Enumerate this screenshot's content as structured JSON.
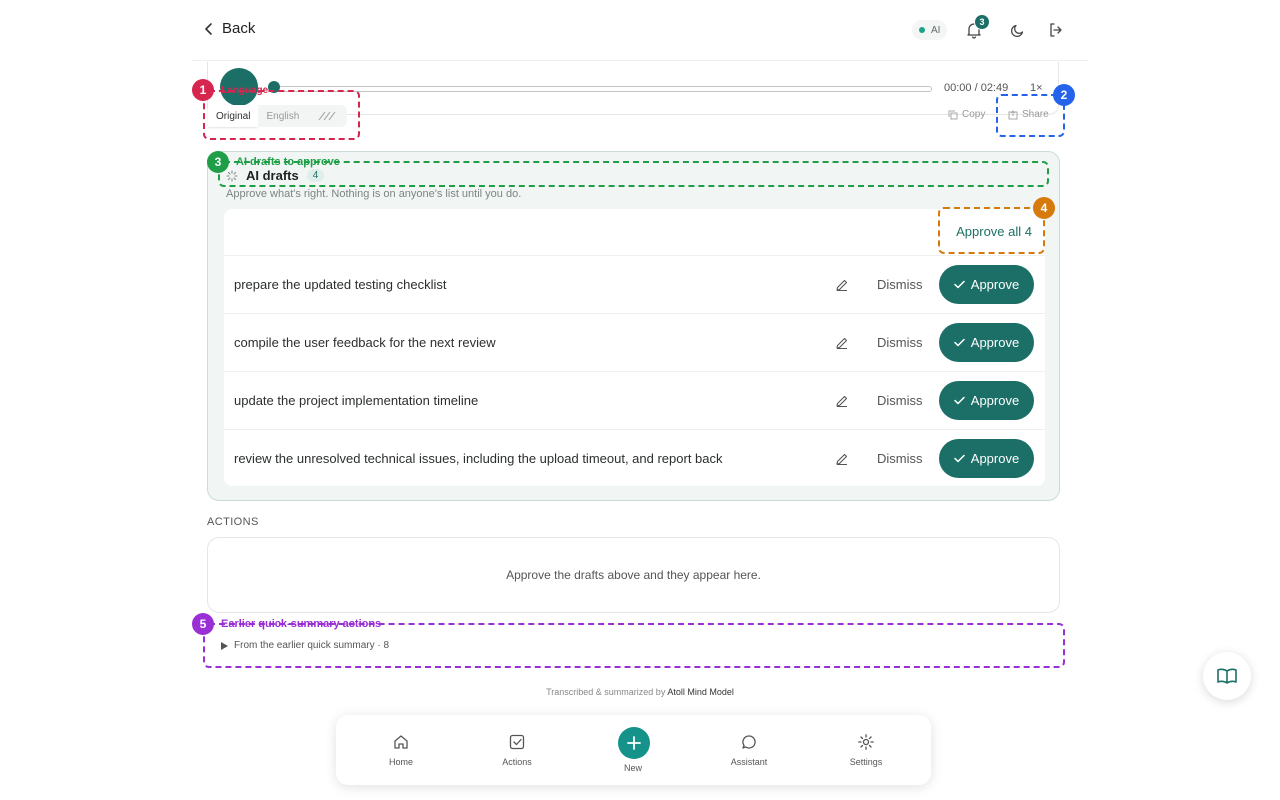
{
  "header": {
    "back_label": "Back",
    "ai_status": "AI",
    "notification_count": "3"
  },
  "player": {
    "time": "00:00 / 02:49",
    "speed": "1×",
    "progress": 0.0
  },
  "language": {
    "original": "Original",
    "english": "English"
  },
  "transcript_actions": {
    "copy": "Copy",
    "share": "Share"
  },
  "drafts": {
    "title": "AI drafts",
    "count": "4",
    "subtitle": "Approve what's right. Nothing is on anyone's list until you do.",
    "approve_all": "Approve all 4",
    "dismiss_label": "Dismiss",
    "approve_label": "Approve",
    "items": [
      {
        "text": "prepare the updated testing checklist"
      },
      {
        "text": "compile the user feedback for the next review"
      },
      {
        "text": "update the project implementation timeline"
      },
      {
        "text": "review the unresolved technical issues, including the upload timeout, and report back"
      }
    ]
  },
  "actions": {
    "label": "ACTIONS",
    "empty": "Approve the drafts above and they appear here."
  },
  "earlier": {
    "label": "From the earlier quick summary · 8"
  },
  "footer": {
    "credit_prefix": "Transcribed & summarized by",
    "credit_model": "Atoll Mind Model"
  },
  "nav": {
    "home": "Home",
    "actions": "Actions",
    "new": "New",
    "assistant": "Assistant",
    "settings": "Settings"
  },
  "annotations": [
    {
      "n": "1",
      "label": "Language",
      "color": "#d6264f"
    },
    {
      "n": "2",
      "label": "",
      "color": "#2563eb"
    },
    {
      "n": "3",
      "label": "AI drafts to approve",
      "color": "#1f9e47"
    },
    {
      "n": "4",
      "label": "",
      "color": "#d67a0b"
    },
    {
      "n": "5",
      "label": "Earlier quick-summary actions",
      "color": "#9a2fd6"
    }
  ],
  "colors": {
    "primary": "#1c6f67",
    "new_button": "#15928a"
  }
}
